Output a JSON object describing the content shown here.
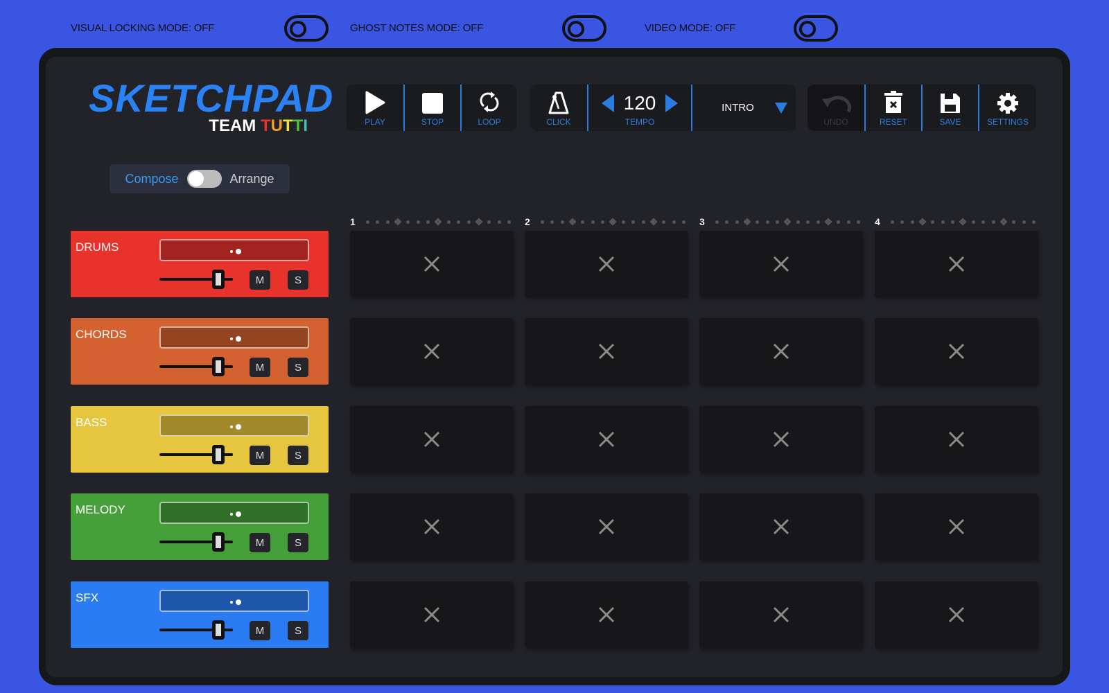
{
  "modes": [
    {
      "label": "VISUAL LOCKING MODE: OFF",
      "on": false
    },
    {
      "label": "GHOST NOTES MODE: OFF",
      "on": false
    },
    {
      "label": "VIDEO MODE: OFF",
      "on": false
    }
  ],
  "logo": {
    "title": "SKETCHPAD",
    "team": "TEAM",
    "tutti": "TUTTI"
  },
  "toolbar": {
    "play": "PLAY",
    "stop": "STOP",
    "loop": "LOOP",
    "click": "CLICK",
    "tempo_value": "120",
    "tempo": "TEMPO",
    "section": "INTRO",
    "undo": "UNDO",
    "reset": "RESET",
    "save": "SAVE",
    "settings": "SETTINGS"
  },
  "view_toggle": {
    "compose": "Compose",
    "arrange": "Arrange",
    "selected": "Compose"
  },
  "bars": [
    "1",
    "2",
    "3",
    "4"
  ],
  "tracks": [
    {
      "name": "DRUMS",
      "color": "#e8332d",
      "mute": "M",
      "solo": "S",
      "volume": 0.8,
      "pan": 0
    },
    {
      "name": "CHORDS",
      "color": "#d46230",
      "mute": "M",
      "solo": "S",
      "volume": 0.8,
      "pan": 0
    },
    {
      "name": "BASS",
      "color": "#e6c63f",
      "mute": "M",
      "solo": "S",
      "volume": 0.8,
      "pan": 0
    },
    {
      "name": "MELODY",
      "color": "#46a03a",
      "mute": "M",
      "solo": "S",
      "volume": 0.8,
      "pan": 0
    },
    {
      "name": "SFX",
      "color": "#2b7bf2",
      "mute": "M",
      "solo": "S",
      "volume": 0.8,
      "pan": 0
    }
  ],
  "colors": {
    "accent": "#2a7de0",
    "background": "#3b55e3"
  }
}
